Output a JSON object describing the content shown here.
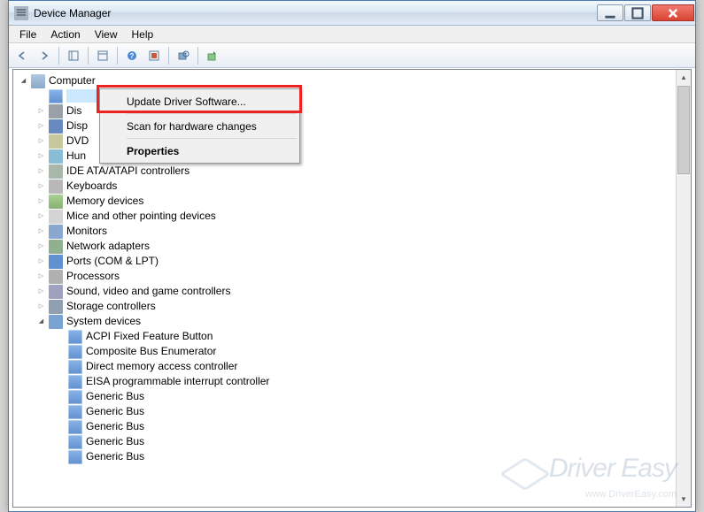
{
  "window": {
    "title": "Device Manager"
  },
  "menu": {
    "file": "File",
    "action": "Action",
    "view": "View",
    "help": "Help"
  },
  "tree": {
    "root": "Computer",
    "selected_child": "",
    "categories": [
      {
        "label": "Disk drives",
        "icon": "disk"
      },
      {
        "label": "Display adapters",
        "icon": "display"
      },
      {
        "label": "DVD/CD-ROM drives",
        "icon": "dvd"
      },
      {
        "label": "Human Interface Devices",
        "icon": "hid"
      },
      {
        "label": "IDE ATA/ATAPI controllers",
        "icon": "ide"
      },
      {
        "label": "Keyboards",
        "icon": "keyboard"
      },
      {
        "label": "Memory devices",
        "icon": "memory"
      },
      {
        "label": "Mice and other pointing devices",
        "icon": "mouse"
      },
      {
        "label": "Monitors",
        "icon": "monitor"
      },
      {
        "label": "Network adapters",
        "icon": "network"
      },
      {
        "label": "Ports (COM & LPT)",
        "icon": "port"
      },
      {
        "label": "Processors",
        "icon": "processor"
      },
      {
        "label": "Sound, video and game controllers",
        "icon": "sound"
      },
      {
        "label": "Storage controllers",
        "icon": "storage"
      }
    ],
    "system_devices_label": "System devices",
    "system_devices": [
      "ACPI Fixed Feature Button",
      "Composite Bus Enumerator",
      "Direct memory access controller",
      "EISA programmable interrupt controller",
      "Generic Bus",
      "Generic Bus",
      "Generic Bus",
      "Generic Bus",
      "Generic Bus"
    ]
  },
  "context_menu": {
    "update": "Update Driver Software...",
    "scan": "Scan for hardware changes",
    "properties": "Properties"
  },
  "watermark": {
    "brand": "Driver Easy",
    "url": "www.DriverEasy.com"
  }
}
